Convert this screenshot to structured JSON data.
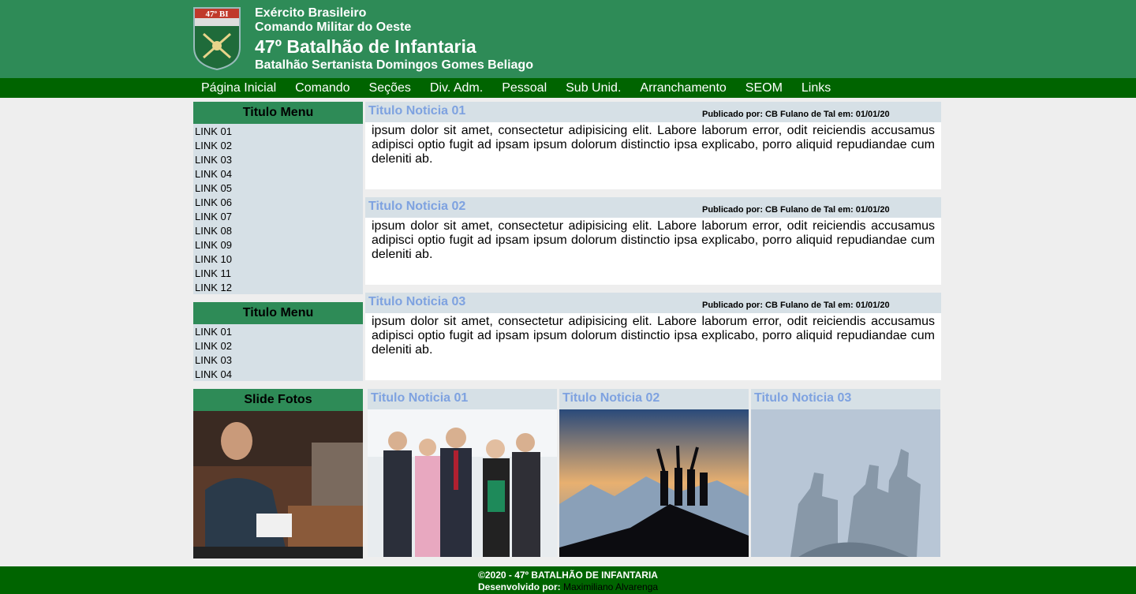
{
  "header": {
    "line1": "Exército Brasileiro",
    "line2": "Comando Militar do Oeste",
    "title": "47º Batalhão de Infantaria",
    "subtitle": "Batalhão Sertanista Domingos Gomes Beliago",
    "emblem_text": "47º BI"
  },
  "nav": [
    "Página Inicial",
    "Comando",
    "Seções",
    "Div. Adm.",
    "Pessoal",
    "Sub Unid.",
    "Arranchamento",
    "SEOM",
    "Links"
  ],
  "menu1": {
    "title": "Titulo Menu",
    "links": [
      "LINK 01",
      "LINK 02",
      "LINK 03",
      "LINK 04",
      "LINK 05",
      "LINK 06",
      "LINK 07",
      "LINK 08",
      "LINK 09",
      "LINK 10",
      "LINK 11",
      "LINK 12"
    ]
  },
  "menu2": {
    "title": "Titulo Menu",
    "links": [
      "LINK 01",
      "LINK 02",
      "LINK 03",
      "LINK 04"
    ]
  },
  "news": [
    {
      "title": "Titulo Noticia 01",
      "meta": "Publicado por: CB Fulano de Tal em: 01/01/20",
      "body": "ipsum dolor sit amet, consectetur adipisicing elit. Labore laborum error, odit reiciendis accusamus adipisci optio fugit ad ipsam ipsum dolorum distinctio ipsa explicabo, porro aliquid repudiandae cum deleniti ab."
    },
    {
      "title": "Titulo Noticia 02",
      "meta": "Publicado por: CB Fulano de Tal em: 01/01/20",
      "body": "ipsum dolor sit amet, consectetur adipisicing elit. Labore laborum error, odit reiciendis accusamus adipisci optio fugit ad ipsam ipsum dolorum distinctio ipsa explicabo, porro aliquid repudiandae cum deleniti ab."
    },
    {
      "title": "Titulo Noticia 03",
      "meta": "Publicado por: CB Fulano de Tal em: 01/01/20",
      "body": "ipsum dolor sit amet, consectetur adipisicing elit. Labore laborum error, odit reiciendis accusamus adipisci optio fugit ad ipsam ipsum dolorum distinctio ipsa explicabo, porro aliquid repudiandae cum deleniti ab."
    }
  ],
  "slide": {
    "title": "Slide Fotos"
  },
  "gallery": [
    {
      "title": "Titulo Noticia 01"
    },
    {
      "title": "Titulo Noticia 02"
    },
    {
      "title": "Titulo Noticia 03"
    }
  ],
  "footer": {
    "copyright": "©2020 - 47º BATALHÃO DE INFANTARIA",
    "dev_label": "Desenvolvido por:",
    "dev_name": "Maximiliano Alvarenga"
  },
  "colors": {
    "header_green": "#2e8b57",
    "nav_green": "#006400",
    "panel_blue": "#d6e0e6",
    "title_blue": "#7ea2e0"
  }
}
